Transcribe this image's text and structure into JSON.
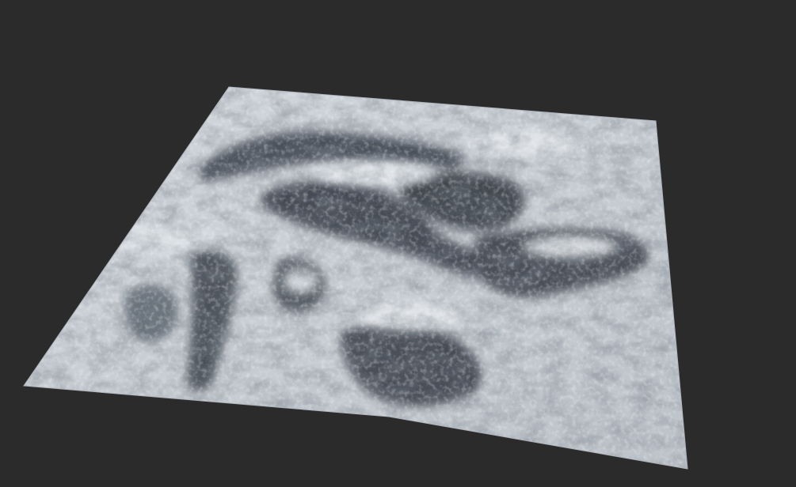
{
  "viewport": {
    "background_color": "#2b2b2b",
    "content": "terrain-heightmap-mesh"
  },
  "terrain": {
    "base_color": "#c9ced4",
    "highlight_color": "#e4e7ea",
    "shadow_color": "#3a414a",
    "deep_shadow_color": "#262c33"
  }
}
